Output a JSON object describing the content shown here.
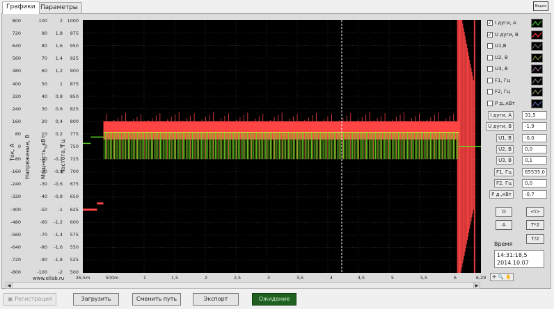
{
  "tabs": [
    "Графики",
    "Параметры"
  ],
  "video_button": "Видео",
  "axes": {
    "current": {
      "title": "Ток, А",
      "ticks": [
        "800",
        "720",
        "640",
        "560",
        "480",
        "400",
        "320",
        "240",
        "160",
        "80",
        "0",
        "-80",
        "-160",
        "-240",
        "-320",
        "-400",
        "-480",
        "-560",
        "-640",
        "-720",
        "-800"
      ]
    },
    "voltage": {
      "title": "Напряжение, В",
      "ticks": [
        "100",
        "90",
        "80",
        "70",
        "60",
        "50",
        "40",
        "30",
        "20",
        "10",
        "0",
        "-10",
        "-20",
        "-30",
        "-40",
        "-50",
        "-60",
        "-70",
        "-80",
        "-90",
        "-100"
      ]
    },
    "power": {
      "title": "Мощность, кВт",
      "ticks": [
        "2",
        "1,8",
        "1,6",
        "1,4",
        "1,2",
        "1",
        "0,8",
        "0,6",
        "0,4",
        "0,2",
        "0",
        "-0,2",
        "-0,4",
        "-0,6",
        "-0,8",
        "-1",
        "-1,2",
        "-1,4",
        "-1,6",
        "-1,8",
        "-2"
      ]
    },
    "frequency": {
      "title": "Частота, Гц",
      "ticks": [
        "1000",
        "975",
        "950",
        "925",
        "900",
        "875",
        "850",
        "825",
        "800",
        "775",
        "750",
        "725",
        "700",
        "675",
        "650",
        "625",
        "600",
        "575",
        "550",
        "525",
        "500"
      ]
    }
  },
  "x_ticks": [
    "26,5m",
    "500m",
    "1",
    "1,5",
    "2",
    "2,5",
    "3",
    "3,5",
    "4",
    "4,5",
    "5",
    "5,5",
    "6",
    "6,29"
  ],
  "url": "www.ellab.ru",
  "legend": [
    {
      "label": "I дуги, А",
      "checked": true,
      "check_mark": "✓",
      "color": "#33cc33"
    },
    {
      "label": "U дуги, В",
      "checked": true,
      "check_mark": "✓",
      "color": "#ff3333"
    },
    {
      "label": "U1,В",
      "checked": false,
      "check_mark": "",
      "color": "#666666"
    },
    {
      "label": "U2, В",
      "checked": false,
      "check_mark": "",
      "color": "#888844"
    },
    {
      "label": "U3, В",
      "checked": false,
      "check_mark": "",
      "color": "#886688"
    },
    {
      "label": "F1, Гц",
      "checked": false,
      "check_mark": "",
      "color": "#777777"
    },
    {
      "label": "F2, Гц",
      "checked": false,
      "check_mark": "",
      "color": "#888866"
    },
    {
      "label": "Р д.,кВт",
      "checked": false,
      "check_mark": "",
      "color": "#5566aa"
    }
  ],
  "values": [
    {
      "label": "I дуги, А",
      "value": "31,5"
    },
    {
      "label": "U дуги, В",
      "value": "-1,9"
    },
    {
      "label": "U1, В",
      "value": "-0,0"
    },
    {
      "label": "U2, В",
      "value": "0,0"
    },
    {
      "label": "U3, В",
      "value": "0,1"
    },
    {
      "label": "F1, Гц",
      "value": "65535,0"
    },
    {
      "label": "F2, Гц",
      "value": "0,0"
    },
    {
      "label": "Р д.,кВт",
      "value": "-0,7"
    }
  ],
  "control_buttons": {
    "zero": "O",
    "cursor": "<I>",
    "a": "A",
    "t_times2": "T*2",
    "t_div2": "T/2"
  },
  "time": {
    "label": "Время",
    "clock": "14:31:18,5",
    "date": "2014.10.07"
  },
  "zoom_tools": "✛ 🔍 ✋",
  "bottom_buttons": {
    "register": "Регистрация",
    "load": "Загрузить",
    "change_path": "Сменить путь",
    "export": "Экспорт",
    "waiting": "Ожидание"
  },
  "chart_data": {
    "type": "line",
    "xlim": [
      0.0265,
      6.29
    ],
    "ylim": [
      -800,
      800
    ],
    "cursor_x": 4.1,
    "grid": true,
    "series": [
      {
        "name": "U дуги, В",
        "color": "#ff4444",
        "band_low": [
          -400,
          -380,
          48,
          48,
          48,
          48,
          48,
          48,
          48,
          48,
          48,
          48,
          48,
          -900
        ],
        "band_high": [
          -400,
          -360,
          150,
          150,
          160,
          145,
          155,
          150,
          140,
          150,
          155,
          150,
          150,
          1000
        ]
      },
      {
        "name": "I дуги, А",
        "color": "#66dd22",
        "band_low": [
          0,
          0,
          -80,
          -80,
          -80,
          -80,
          -80,
          -80,
          -80,
          -80,
          -80,
          -80,
          -80,
          0
        ],
        "band_high": [
          40,
          60,
          90,
          90,
          90,
          90,
          90,
          90,
          90,
          90,
          90,
          90,
          90,
          0
        ]
      }
    ]
  }
}
